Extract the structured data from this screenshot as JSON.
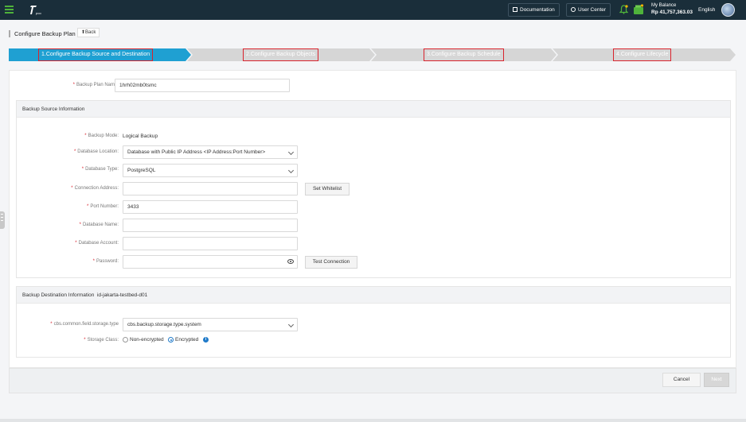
{
  "topbar": {
    "documentation": "Documentation",
    "user_center": "User Center",
    "balance_label": "My Balance",
    "balance_value": "Rp 41,757,363.03",
    "language": "English",
    "accent_color": "#4fb33b"
  },
  "header": {
    "title": "Configure Backup Plan",
    "back": "Back"
  },
  "steps": [
    {
      "label": "1.Configure Backup Source and Destination",
      "active": true
    },
    {
      "label": "2.Configure Backup Objects",
      "active": false
    },
    {
      "label": "3.Configure Backup Schedule",
      "active": false
    },
    {
      "label": "4.Configure Lifecycle",
      "active": false
    }
  ],
  "form": {
    "plan_name_label": "Backup Plan Name:",
    "plan_name_value": "1hrh02mb0tsmc",
    "source_section": "Backup Source Information",
    "backup_mode_label": "Backup Mode:",
    "backup_mode_value": "Logical Backup",
    "db_location_label": "Database Location:",
    "db_location_value": "Database with Public IP Address <IP Address:Port Number>",
    "db_type_label": "Database Type:",
    "db_type_value": "PostgreSQL",
    "conn_addr_label": "Connection Address:",
    "conn_addr_value": "",
    "set_whitelist": "Set Whitelist",
    "port_label": "Port Number:",
    "port_value": "3433",
    "db_name_label": "Database Name:",
    "db_name_value": "",
    "db_account_label": "Database Account:",
    "db_account_value": "",
    "password_label": "Password:",
    "password_value": "",
    "test_connection": "Test Connection",
    "dest_section": "Backup Destination Information",
    "dest_region": "id-jakarta-testbed-d01",
    "storage_type_label": "cbs.common.field.storage.type",
    "storage_type_value": "cbs.backup.storage.type.system",
    "storage_class_label": "Storage Class:",
    "non_encrypted": "Non-encrypted",
    "encrypted": "Encrypted",
    "encrypted_selected": true
  },
  "footer": {
    "cancel": "Cancel",
    "next": "Next"
  },
  "colors": {
    "active_step": "#1fa0d2",
    "inactive_step": "#d6d6d6",
    "step_highlight": "#d9232d",
    "required": "#d9232d"
  }
}
